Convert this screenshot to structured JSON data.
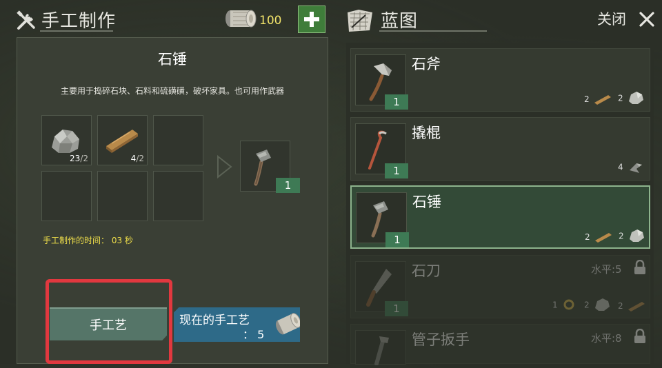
{
  "crafting": {
    "title": "手工制作",
    "currency": "100",
    "item_name": "石锤",
    "item_desc": "主要用于捣碎石块、石料和硫磺磺，破坏家具。也可用作武器",
    "ingredients": [
      {
        "name": "石头",
        "have": "23",
        "need": "/2"
      },
      {
        "name": "木材",
        "have": "4",
        "need": "/2"
      }
    ],
    "result_count": "1",
    "craft_time_label": "手工制作的时间：",
    "craft_time_value": "03 秒",
    "craft_button": "手工艺",
    "current_label_line1": "现在的手工艺",
    "current_label_line2": "：  5"
  },
  "blueprints": {
    "title": "蓝图",
    "close_label": "关闭",
    "items": [
      {
        "name": "石斧",
        "count": "1",
        "materials": [
          "2",
          "2"
        ],
        "level": ""
      },
      {
        "name": "撬棍",
        "count": "1",
        "materials": [
          "4"
        ],
        "level": ""
      },
      {
        "name": "石锤",
        "count": "1",
        "materials": [
          "2",
          "2"
        ],
        "level": "",
        "selected": true
      },
      {
        "name": "石刀",
        "count": "1",
        "materials": [
          "1",
          "2",
          "2"
        ],
        "level": "水平:5",
        "locked": true
      },
      {
        "name": "管子扳手",
        "count": "",
        "materials": [],
        "level": "水平:8",
        "locked": true
      }
    ]
  },
  "colors": {
    "accent_green": "#3e7a55",
    "highlight_border": "#8db48d",
    "craft_time_yellow": "#f0df4a",
    "current_button_blue": "#2e6a88",
    "annotation_red": "#e1383f"
  }
}
